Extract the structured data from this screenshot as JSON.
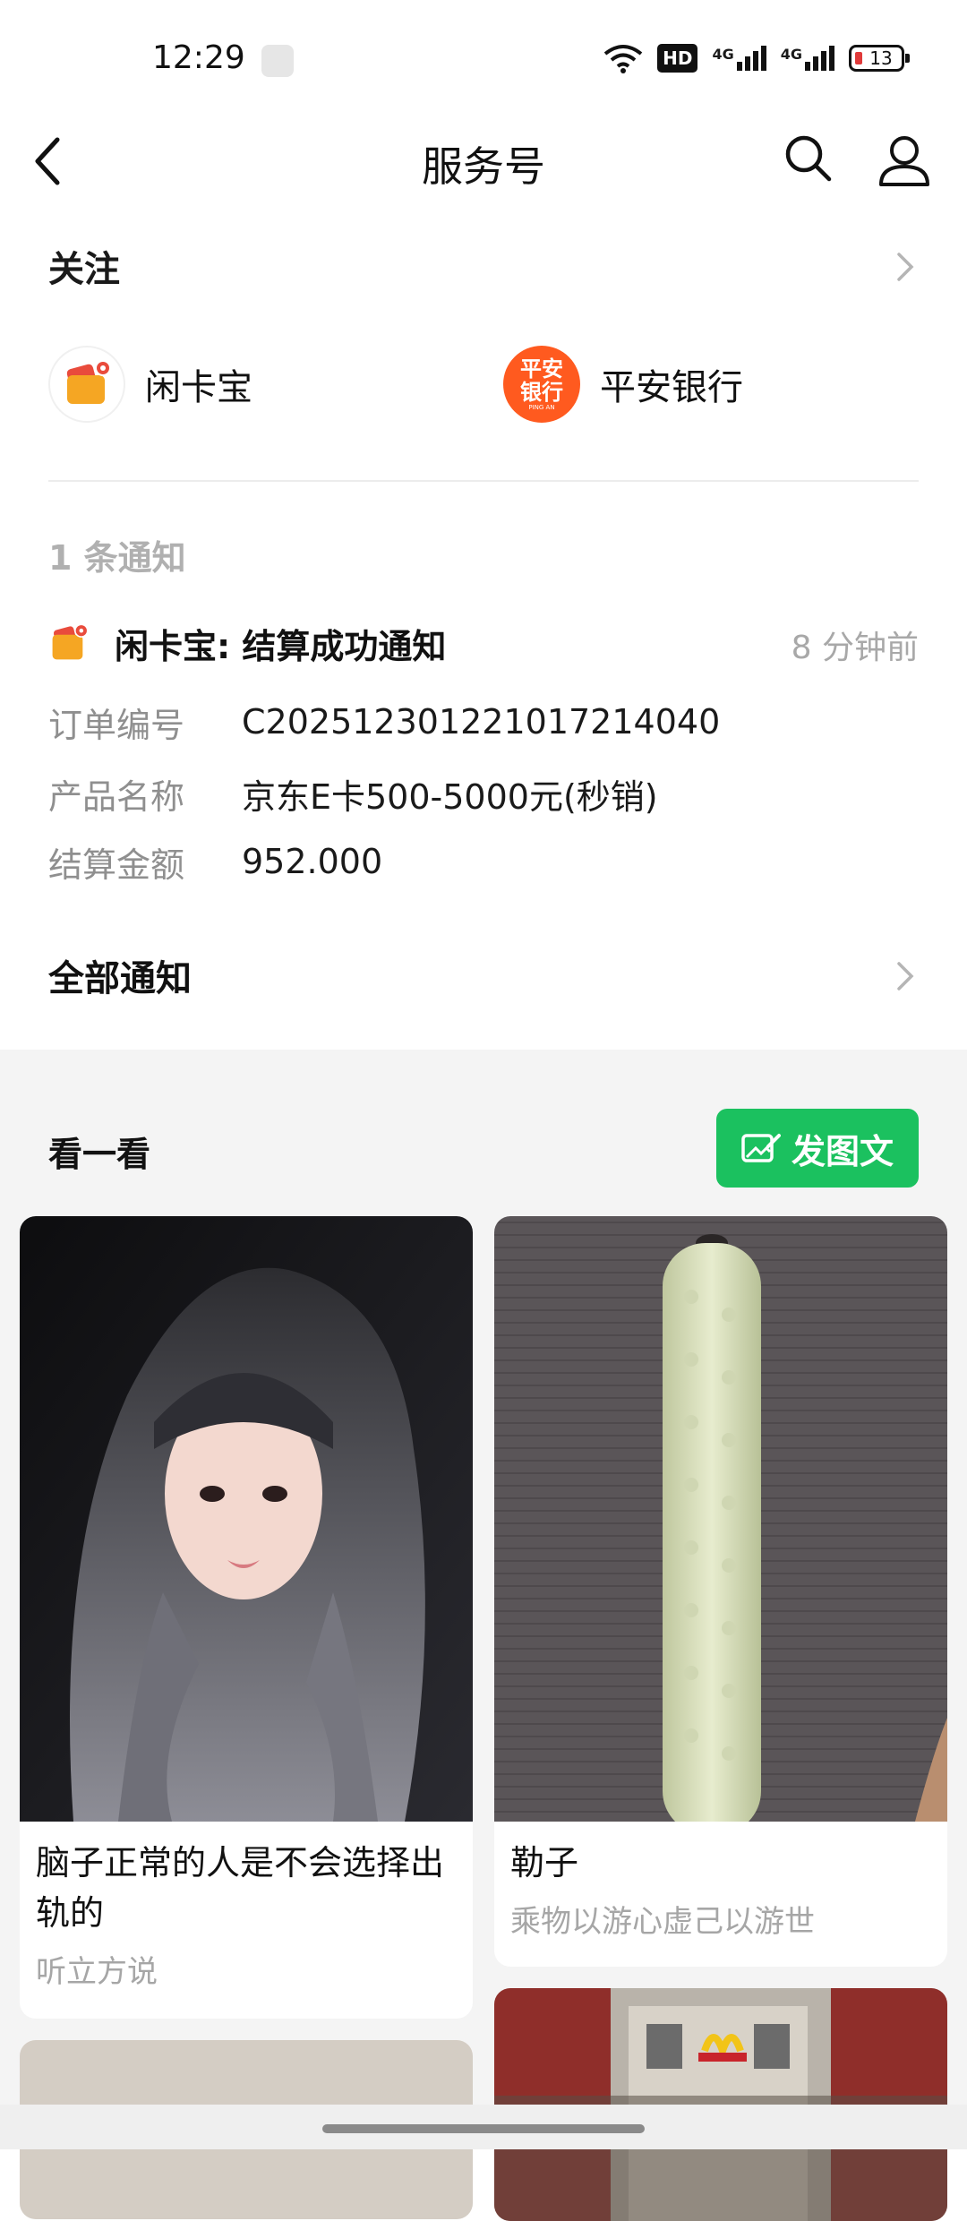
{
  "status_bar": {
    "time": "12:29",
    "hd_label": "HD",
    "network_1": "4G",
    "network_2": "4G",
    "battery": "13"
  },
  "header": {
    "title": "服务号",
    "icons": [
      "back-chevron-icon",
      "search-icon",
      "user-icon"
    ]
  },
  "follow": {
    "title": "关注",
    "accounts": [
      {
        "name": "闲卡宝",
        "icon": "wallet-icon",
        "color": "#f5a623"
      },
      {
        "name": "平安银行",
        "icon": "pingan-logo",
        "color": "#ff5a1f",
        "logo_text_top": "平安",
        "logo_text_bottom": "银行",
        "logo_small": "PING AN"
      }
    ]
  },
  "notification": {
    "count_label": "1 条通知",
    "title": "闲卡宝: 结算成功通知",
    "time": "8 分钟前",
    "rows": [
      {
        "label": "订单编号",
        "value": "C202512301221017214040"
      },
      {
        "label": "产品名称",
        "value": "京东E卡500-5000元(秒销)"
      },
      {
        "label": "结算金额",
        "value": "952.000"
      }
    ],
    "all_label": "全部通知"
  },
  "look": {
    "title": "看一看",
    "post_button": "发图文",
    "accent": "#1bc15f",
    "cards": [
      {
        "title": "脑子正常的人是不会选择出轨的",
        "sub": "听立方说"
      },
      {
        "title": "勒子",
        "sub": "乘物以游心虚己以游世"
      },
      {
        "title": "",
        "sub": ""
      },
      {
        "title": "",
        "sub": ""
      }
    ]
  }
}
